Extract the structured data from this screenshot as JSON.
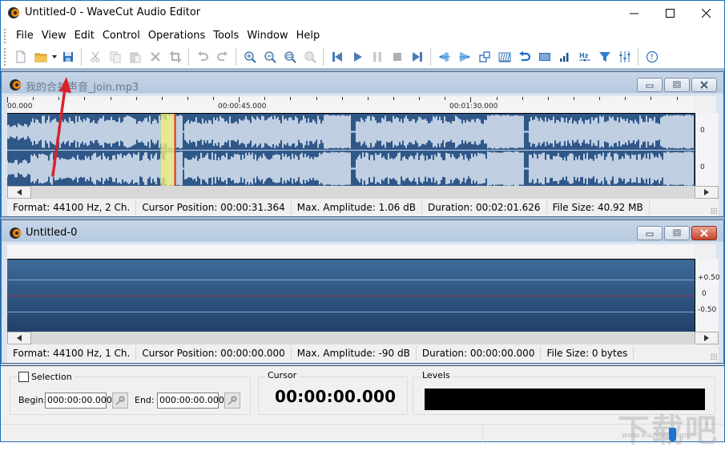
{
  "window": {
    "title": "Untitled-0 - WaveCut Audio Editor",
    "controls": {
      "minimize": "minimize",
      "maximize": "maximize",
      "close": "close"
    }
  },
  "menu": [
    "File",
    "View",
    "Edit",
    "Control",
    "Operations",
    "Tools",
    "Window",
    "Help"
  ],
  "toolbar": {
    "groups": [
      [
        {
          "name": "new-file",
          "icon": "new-document-icon",
          "enabled": true
        },
        {
          "name": "open-file",
          "icon": "folder-icon",
          "enabled": true,
          "dropdown": true
        },
        {
          "name": "save-file",
          "icon": "save-icon",
          "enabled": true
        }
      ],
      [
        {
          "name": "cut",
          "icon": "scissors-icon",
          "enabled": false
        },
        {
          "name": "copy",
          "icon": "copy-icon",
          "enabled": false
        },
        {
          "name": "paste",
          "icon": "paste-icon",
          "enabled": false
        },
        {
          "name": "delete",
          "icon": "delete-x-icon",
          "enabled": false
        },
        {
          "name": "crop",
          "icon": "crop-icon",
          "enabled": false
        }
      ],
      [
        {
          "name": "undo",
          "icon": "undo-icon",
          "enabled": false
        },
        {
          "name": "redo",
          "icon": "redo-icon",
          "enabled": false
        }
      ],
      [
        {
          "name": "zoom-in",
          "icon": "zoom-in-icon",
          "enabled": true
        },
        {
          "name": "zoom-out",
          "icon": "zoom-out-icon",
          "enabled": true
        },
        {
          "name": "zoom-all",
          "icon": "zoom-all-icon",
          "enabled": true
        },
        {
          "name": "zoom-selection",
          "icon": "zoom-selection-icon",
          "enabled": false
        }
      ],
      [
        {
          "name": "go-to-start",
          "icon": "skip-back-icon",
          "enabled": true
        },
        {
          "name": "play",
          "icon": "play-icon",
          "enabled": true
        },
        {
          "name": "pause",
          "icon": "pause-icon",
          "enabled": false
        },
        {
          "name": "stop",
          "icon": "stop-icon",
          "enabled": false
        },
        {
          "name": "go-to-end",
          "icon": "skip-forward-icon",
          "enabled": true
        }
      ],
      [
        {
          "name": "fade-in",
          "icon": "fade-in-icon",
          "enabled": true
        },
        {
          "name": "fade-out",
          "icon": "fade-out-icon",
          "enabled": true
        },
        {
          "name": "resize",
          "icon": "resize-icon",
          "enabled": true
        },
        {
          "name": "silence",
          "icon": "silence-icon",
          "enabled": true
        },
        {
          "name": "reverse",
          "icon": "reverse-icon",
          "enabled": true
        },
        {
          "name": "normalize",
          "icon": "normalize-icon",
          "enabled": true
        },
        {
          "name": "amplify",
          "icon": "amplify-icon",
          "enabled": true
        },
        {
          "name": "sample-rate",
          "icon": "hz-icon",
          "enabled": true
        },
        {
          "name": "filter",
          "icon": "filter-icon",
          "enabled": true
        },
        {
          "name": "equalizer",
          "icon": "equalizer-icon",
          "enabled": true
        }
      ],
      [
        {
          "name": "help",
          "icon": "help-icon",
          "enabled": true
        }
      ]
    ]
  },
  "documents": [
    {
      "title": "我的合并声音_join.mp3",
      "active": false,
      "ruler": {
        "labels": [
          {
            "text": "00.000",
            "seconds": 0
          },
          {
            "text": "00:00:45.000",
            "seconds": 45
          },
          {
            "text": "00:01:30.000",
            "seconds": 90
          }
        ],
        "visible_seconds": 133.5
      },
      "channels": 2,
      "amp_labels": [
        "0",
        "0"
      ],
      "selection_seconds": [
        29.8,
        32.6
      ],
      "cursor_seconds": 31.364,
      "status": {
        "format": "Format: 44100 Hz, 2 Ch.",
        "cursor": "Cursor Position: 00:00:31.364",
        "amplitude": "Max. Amplitude: 1.06 dB",
        "duration": "Duration: 00:02:01.626",
        "filesize": "File Size: 40.92 MB"
      }
    },
    {
      "title": "Untitled-0",
      "active": true,
      "channels": 1,
      "amp_labels": [
        "+0.50",
        "0",
        "-0.50"
      ],
      "status": {
        "format": "Format: 44100 Hz, 1 Ch.",
        "cursor": "Cursor Position: 00:00:00.000",
        "amplitude": "Max. Amplitude: -90 dB",
        "duration": "Duration: 00:00:00.000",
        "filesize": "File Size: 0 bytes"
      }
    }
  ],
  "bottom": {
    "selection": {
      "label": "Selection",
      "checked": false,
      "begin_label": "Begin:",
      "begin_value": "000:00:00.000",
      "end_label": "End:",
      "end_value": "000:00:00.000"
    },
    "cursor": {
      "label": "Cursor",
      "value": "00:00:00.000"
    },
    "levels": {
      "label": "Levels"
    },
    "watermark": {
      "text": "下载吧",
      "url": "www.xiazaiba.com"
    }
  },
  "colors": {
    "wave_bg": "#2f5889",
    "wave_fg": "#e4edf8",
    "selection": "#eef07a",
    "cursor_line": "#e03030",
    "annotation_arrow": "#d9232b",
    "window_border": "#1e6fb8"
  }
}
